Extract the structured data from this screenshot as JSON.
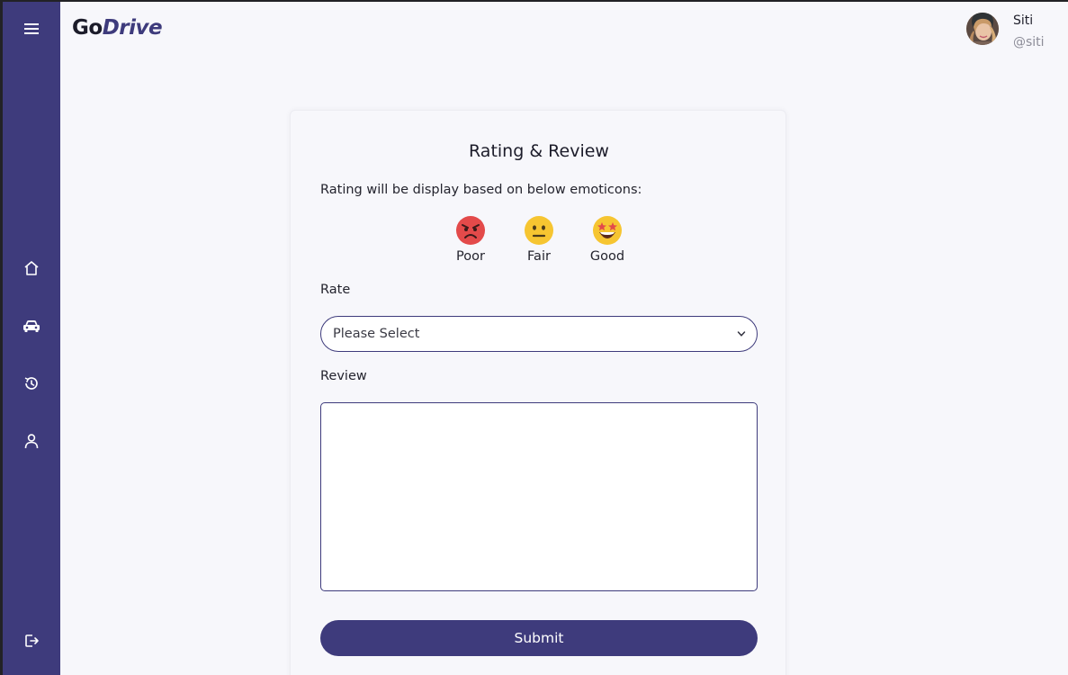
{
  "app": {
    "brand_prefix": "Go",
    "brand_suffix": "Drive"
  },
  "user": {
    "name": "Siti",
    "handle": "@siti"
  },
  "sidebar": {
    "items": [
      {
        "icon": "menu-icon"
      },
      {
        "icon": "home-icon"
      },
      {
        "icon": "car-icon"
      },
      {
        "icon": "history-icon"
      },
      {
        "icon": "user-icon"
      },
      {
        "icon": "logout-icon"
      }
    ]
  },
  "form": {
    "title": "Rating & Review",
    "description": "Rating will be display based on below emoticons:",
    "emoticons": [
      {
        "label": "Poor",
        "icon": "angry-face-icon",
        "color": "#e34a4a"
      },
      {
        "label": "Fair",
        "icon": "neutral-face-icon",
        "color": "#f6c531"
      },
      {
        "label": "Good",
        "icon": "star-struck-face-icon",
        "color": "#f6c531"
      }
    ],
    "rate_label": "Rate",
    "rate_value": "Please Select",
    "review_label": "Review",
    "review_value": "",
    "submit_label": "Submit"
  },
  "colors": {
    "accent": "#3e3b7c",
    "background": "#f7f7fb"
  }
}
